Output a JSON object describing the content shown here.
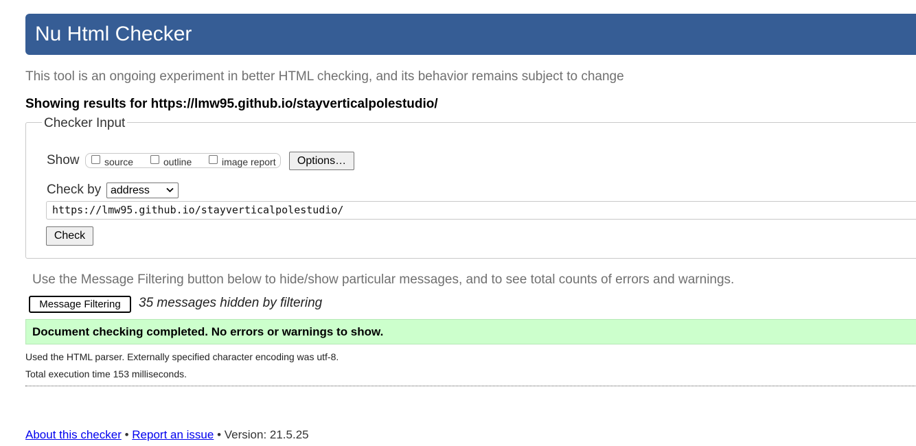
{
  "header": {
    "title": "Nu Html Checker"
  },
  "intro": {
    "subtitle": "This tool is an ongoing experiment in better HTML checking, and its behavior remains subject to change",
    "results_for": "Showing results for https://lmw95.github.io/stayverticalpolestudio/"
  },
  "checker_input": {
    "legend": "Checker Input",
    "show_label": "Show",
    "show_options": [
      {
        "label": "source",
        "checked": false
      },
      {
        "label": "outline",
        "checked": false
      },
      {
        "label": "image report",
        "checked": false
      }
    ],
    "options_button": "Options…",
    "check_by_label": "Check by",
    "check_by_selected": "address",
    "url_value": "https://lmw95.github.io/stayverticalpolestudio/",
    "check_button": "Check"
  },
  "filtering": {
    "note": "Use the Message Filtering button below to hide/show particular messages, and to see total counts of errors and warnings.",
    "button": "Message Filtering",
    "hidden_count": "35 messages hidden by filtering"
  },
  "result": {
    "message": "Document checking completed. No errors or warnings to show.",
    "parser_note": "Used the HTML parser. Externally specified character encoding was utf-8.",
    "execution_time": "Total execution time 153 milliseconds."
  },
  "footer": {
    "about_link": "About this checker",
    "separator": " • ",
    "report_link": "Report an issue",
    "version": "Version: 21.5.25"
  },
  "colors": {
    "banner": "#365d95",
    "success_bg": "#ccffcc",
    "link": "#0000ee",
    "muted_text": "#707070"
  }
}
